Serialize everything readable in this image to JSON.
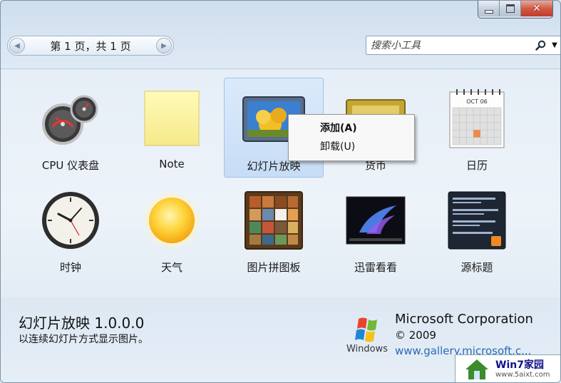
{
  "window": {
    "caption_buttons": {
      "minimize_icon": "minimize-icon",
      "maximize_icon": "maximize-icon",
      "close_label": "✕"
    }
  },
  "toolbar": {
    "pager": {
      "text": "第 1 页，共 1 页",
      "prev_icon": "chevron-left-icon",
      "next_icon": "chevron-right-icon"
    },
    "search": {
      "placeholder": "搜索小工具",
      "icon": "search-icon",
      "dropdown_icon": "chevron-down-icon"
    }
  },
  "gadgets": [
    {
      "label": "CPU 仪表盘",
      "icon": "cpu-meter-icon",
      "selected": false
    },
    {
      "label": "Note",
      "icon": "sticky-note-icon",
      "selected": false
    },
    {
      "label": "幻灯片放映",
      "icon": "slideshow-icon",
      "selected": true
    },
    {
      "label": "货币",
      "icon": "currency-icon",
      "selected": false
    },
    {
      "label": "日历",
      "icon": "calendar-icon",
      "selected": false
    },
    {
      "label": "时钟",
      "icon": "clock-icon",
      "selected": false
    },
    {
      "label": "天气",
      "icon": "weather-sun-icon",
      "selected": false
    },
    {
      "label": "图片拼图板",
      "icon": "picture-puzzle-icon",
      "selected": false
    },
    {
      "label": "迅雷看看",
      "icon": "xunlei-kankan-icon",
      "selected": false
    },
    {
      "label": "源标题",
      "icon": "feed-headlines-icon",
      "selected": false
    }
  ],
  "calendar_icon": {
    "month": "OCT 06"
  },
  "context_menu": {
    "items": [
      {
        "label": "添加(A)",
        "bold": true
      },
      {
        "label": "卸载(U)",
        "bold": false
      }
    ]
  },
  "details": {
    "title": "幻灯片放映 1.0.0.0",
    "description": "以连续幻灯片方式显示图片。",
    "publisher": "Microsoft Corporation",
    "copyright": "© 2009",
    "link": "www.gallery.microsoft.c...",
    "logo_text": "Windows"
  },
  "watermark": {
    "brand": "Win7家园",
    "url": "www.5aixt.com"
  },
  "colors": {
    "selection": "#c7ddf6",
    "link": "#2a6ab4",
    "close_button": "#c0392b"
  }
}
